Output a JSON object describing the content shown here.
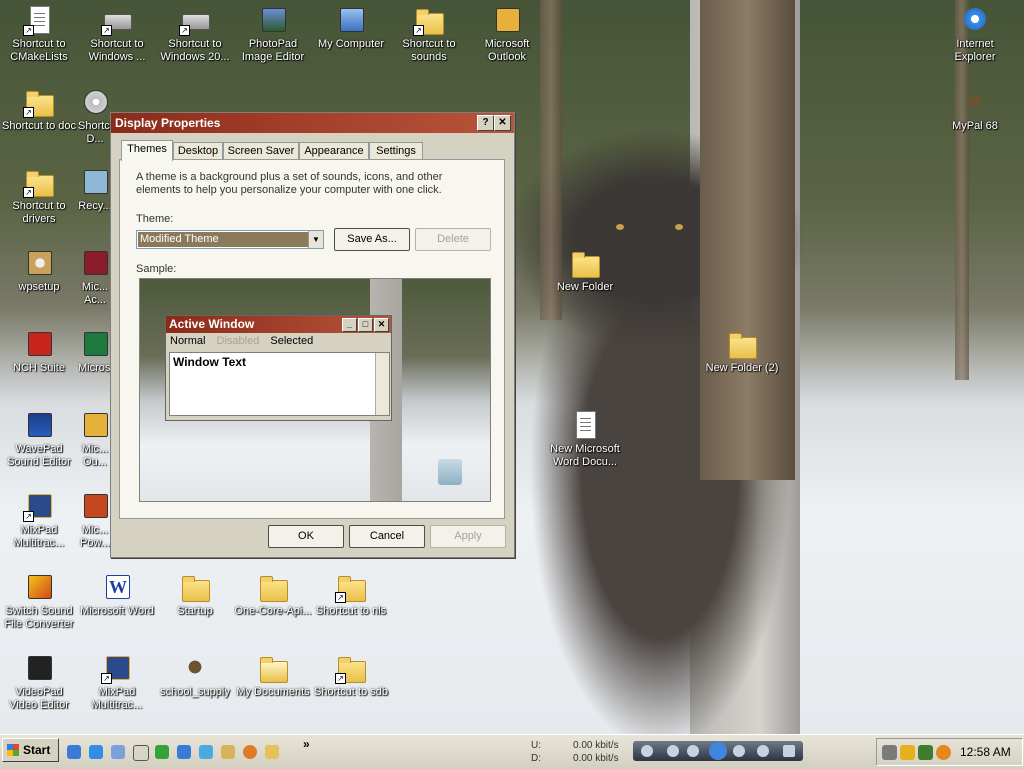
{
  "desktop_icons": [
    {
      "label": "Shortcut to\nCMakeLists",
      "icon": "document-icon"
    },
    {
      "label": "Shortcut to\nWindows ...",
      "icon": "drive-icon"
    },
    {
      "label": "Shortcut to\nWindows 20...",
      "icon": "drive-icon"
    },
    {
      "label": "PhotoPad\nImage Editor",
      "icon": "photopad-icon"
    },
    {
      "label": "My Computer",
      "icon": "computer-icon"
    },
    {
      "label": "Shortcut to\nsounds",
      "icon": "folder-icon"
    },
    {
      "label": "Microsoft\nOutlook",
      "icon": "outlook-icon"
    },
    {
      "label": "Internet\nExplorer",
      "icon": "ie-icon"
    },
    {
      "label": "Shortcut to doc",
      "icon": "folder-icon"
    },
    {
      "label": "Shortcu...\nD...",
      "icon": "cd-icon"
    },
    {
      "label": "MyPal 68",
      "icon": "mypal-icon"
    },
    {
      "label": "Shortcut to\ndrivers",
      "icon": "folder-icon"
    },
    {
      "label": "Recy...",
      "icon": "recycle-icon"
    },
    {
      "label": "wpsetup",
      "icon": "setup-icon"
    },
    {
      "label": "Mic...\nAc...",
      "icon": "access-icon"
    },
    {
      "label": "NCH Suite",
      "icon": "nch-icon"
    },
    {
      "label": "Micros...",
      "icon": "excel-icon"
    },
    {
      "label": "WavePad\nSound Editor",
      "icon": "wavepad-icon"
    },
    {
      "label": "Mic...\nOu...",
      "icon": "outlook-icon"
    },
    {
      "label": "MixPad\nMultitrac...",
      "icon": "mixpad-icon"
    },
    {
      "label": "Mic...\nPow...",
      "icon": "powerpoint-icon"
    },
    {
      "label": "Switch Sound\nFile Converter",
      "icon": "switch-icon"
    },
    {
      "label": "Microsoft Word",
      "icon": "word-icon"
    },
    {
      "label": "Startup",
      "icon": "folder-icon"
    },
    {
      "label": "One-Core-Api...",
      "icon": "zip-folder-icon"
    },
    {
      "label": "Shortcut to nls",
      "icon": "folder-icon"
    },
    {
      "label": "VideoPad\nVideo Editor",
      "icon": "videopad-icon"
    },
    {
      "label": "MixPad\nMultitrac...",
      "icon": "mixpad-icon"
    },
    {
      "label": "school_supply",
      "icon": "mypal-icon"
    },
    {
      "label": "My Documents",
      "icon": "mydocs-icon"
    },
    {
      "label": "Shortcut to sdb",
      "icon": "folder-icon"
    },
    {
      "label": "New Folder",
      "icon": "folder-icon"
    },
    {
      "label": "New Folder (2)",
      "icon": "folder-icon"
    },
    {
      "label": "New Microsoft\nWord Docu...",
      "icon": "word-doc-icon"
    }
  ],
  "dialog": {
    "title": "Display Properties",
    "help_btn": "?",
    "close_btn": "✕",
    "tabs": [
      "Themes",
      "Desktop",
      "Screen Saver",
      "Appearance",
      "Settings"
    ],
    "active_tab": "Themes",
    "description": "A theme is a background plus a set of sounds, icons, and other elements to help you personalize your computer with one click.",
    "theme_label": "Theme:",
    "theme_value": "Modified Theme",
    "save_as": "Save As...",
    "delete": "Delete",
    "sample_label": "Sample:",
    "sample": {
      "title": "Active Window",
      "menu_normal": "Normal",
      "menu_disabled": "Disabled",
      "menu_selected": "Selected",
      "window_text": "Window Text"
    },
    "ok": "OK",
    "cancel": "Cancel",
    "apply": "Apply"
  },
  "taskbar": {
    "start_label": "Start",
    "chevron": "»",
    "upload_label": "U:",
    "download_label": "D:",
    "upload_rate": "0.00 kbit/s",
    "download_rate": "0.00 kbit/s",
    "clock": "12:58 AM"
  }
}
